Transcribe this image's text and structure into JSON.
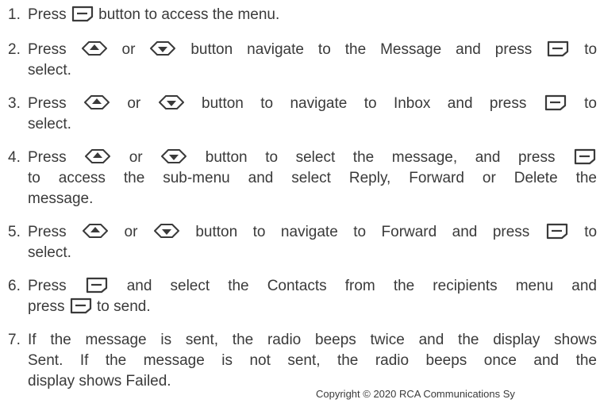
{
  "steps": [
    {
      "number": "1.",
      "line1_a": "Press",
      "line1_b": "button to access the menu."
    },
    {
      "number": "2.",
      "line1_a": "Press",
      "line1_b": "or",
      "line1_c": "button navigate to the Message and press",
      "line1_d": "to",
      "line2": "select."
    },
    {
      "number": "3.",
      "line1_a": "Press",
      "line1_b": "or",
      "line1_c": "button to navigate to Inbox and press",
      "line1_d": "to",
      "line2": "select."
    },
    {
      "number": "4.",
      "line1_a": "Press",
      "line1_b": "or",
      "line1_c": "button to select the message, and press",
      "line2": "to access the sub-menu and select Reply, Forward or Delete the",
      "line3": "message."
    },
    {
      "number": "5.",
      "line1_a": "Press",
      "line1_b": "or",
      "line1_c": "button to navigate to Forward and press",
      "line1_d": "to",
      "line2": "select."
    },
    {
      "number": "6.",
      "line1_a": "Press",
      "line1_b": "and select the Contacts from the recipients menu and",
      "line2_a": "press",
      "line2_b": "to send."
    },
    {
      "number": "7.",
      "line1": "If the message is sent, the radio beeps twice and the display shows",
      "line2": "Sent. If the message is not sent, the radio beeps once and the",
      "line3": "display shows Failed."
    }
  ],
  "footer": "Copyright © 2020 RCA Communications Sy",
  "icons": [
    "menu-button-icon",
    "up-arrow-button-icon",
    "down-arrow-button-icon"
  ],
  "colors": {
    "text": "#3a3a3a",
    "background": "#ffffff"
  }
}
